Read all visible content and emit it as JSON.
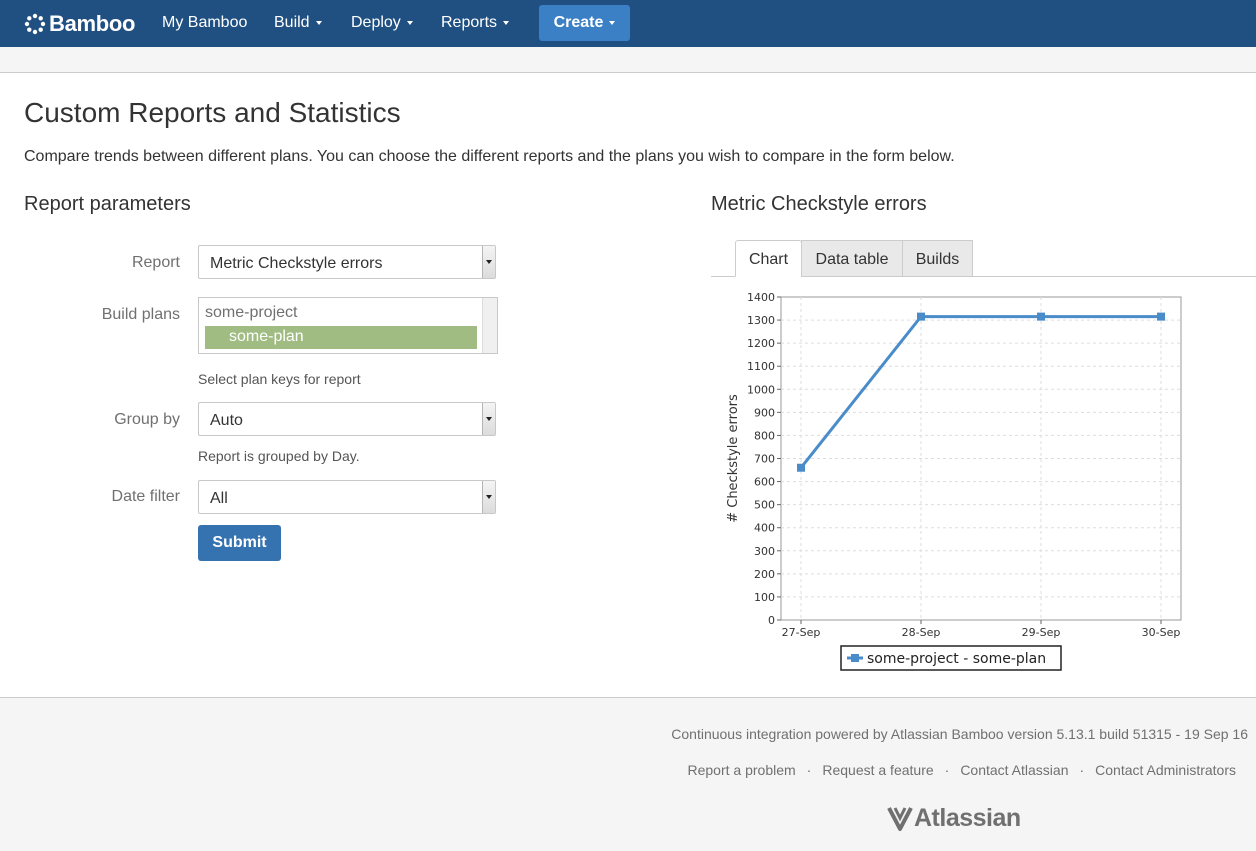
{
  "header": {
    "brand": "Bamboo",
    "nav": {
      "my_bamboo": "My Bamboo",
      "build": "Build",
      "deploy": "Deploy",
      "reports": "Reports"
    },
    "create_label": "Create"
  },
  "page": {
    "title": "Custom Reports and Statistics",
    "description": "Compare trends between different plans. You can choose the different reports and the plans you wish to compare in the form below."
  },
  "form": {
    "heading": "Report parameters",
    "report_label": "Report",
    "report_value": "Metric Checkstyle errors",
    "build_plans_label": "Build plans",
    "build_plans_group": "some-project",
    "build_plans_selected": "some-plan",
    "build_plans_hint": "Select plan keys for report",
    "group_by_label": "Group by",
    "group_by_value": "Auto",
    "group_by_hint": "Report is grouped by Day.",
    "date_filter_label": "Date filter",
    "date_filter_value": "All",
    "submit_label": "Submit"
  },
  "report_panel": {
    "heading": "Metric Checkstyle errors",
    "tabs": [
      "Chart",
      "Data table",
      "Builds"
    ],
    "active_tab": "Chart"
  },
  "chart_data": {
    "type": "line",
    "categories": [
      "27-Sep",
      "28-Sep",
      "29-Sep",
      "30-Sep"
    ],
    "series": [
      {
        "name": "some-project - some-plan",
        "values": [
          660,
          1315,
          1315,
          1315
        ],
        "color": "#4a8cca"
      }
    ],
    "ylabel": "# Checkstyle errors",
    "xlabel": "",
    "ylim": [
      0,
      1400
    ],
    "yticks": [
      0,
      100,
      200,
      300,
      400,
      500,
      600,
      700,
      800,
      900,
      1000,
      1100,
      1200,
      1300,
      1400
    ],
    "grid": true,
    "legend": "bottom"
  },
  "footer": {
    "powered_by": "Continuous integration powered by Atlassian Bamboo version 5.13.1 build 51315 - 19 Sep 16",
    "links": [
      "Report a problem",
      "Request a feature",
      "Contact Atlassian",
      "Contact Administrators"
    ],
    "separator": "·",
    "logo_text": "Atlassian"
  },
  "colors": {
    "header_bg": "#205081",
    "create_button": "#3b7fc4",
    "submit_button": "#3572b0",
    "selected_option": "#a0bc82"
  },
  "icons": [
    "bamboo-logo-icon",
    "caret-down-icon",
    "select-arrow-icon",
    "atlassian-logo-icon"
  ]
}
